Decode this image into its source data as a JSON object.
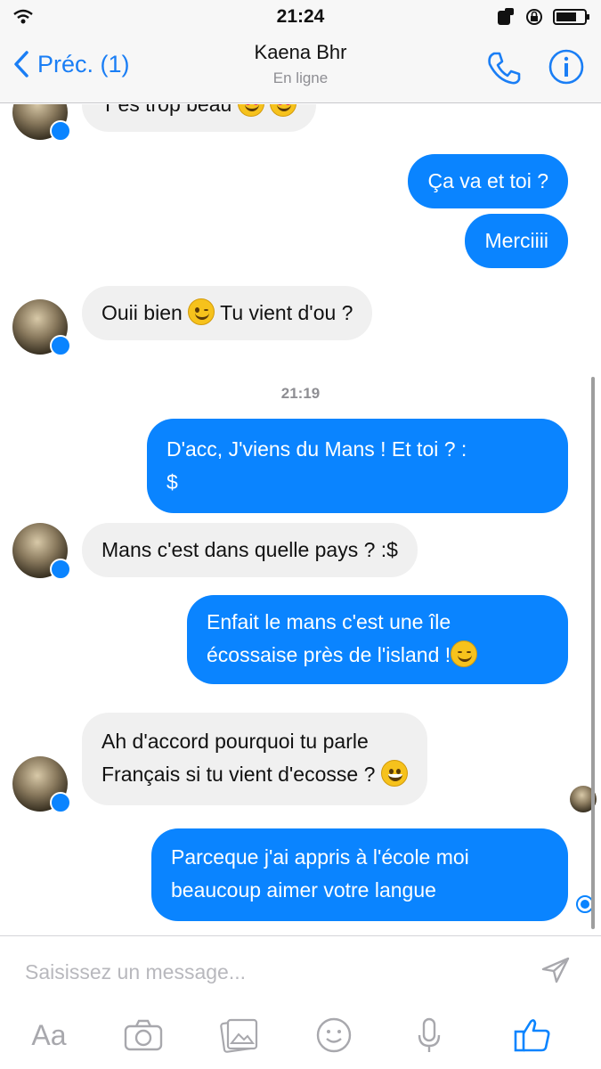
{
  "status_bar": {
    "time": "21:24"
  },
  "nav": {
    "back_label": "Préc. (1)",
    "contact_name": "Kaena Bhr",
    "presence": "En ligne"
  },
  "messages": [
    {
      "direction": "in",
      "text": "T'es trop beau"
    },
    {
      "direction": "out",
      "text": "Ça va et toi ?"
    },
    {
      "direction": "out",
      "text": "Merciiii"
    },
    {
      "direction": "in",
      "text_a": "Ouii bien",
      "text_b": "Tu vient d'ou ?"
    },
    {
      "direction": "out",
      "text_line1": "D'acc, J'viens du Mans ! Et toi ? :",
      "text_line2": "$"
    },
    {
      "direction": "in",
      "text": "Mans c'est dans quelle pays ? :$"
    },
    {
      "direction": "out",
      "text_line1": "Enfait le mans c'est une île",
      "text_line2": "écossaise près de l'island !"
    },
    {
      "direction": "in",
      "text_line1": "Ah d'accord pourquoi tu parle",
      "text_line2": "Français si tu vient d'ecosse ?"
    },
    {
      "direction": "out",
      "text_line1": "Parceque j'ai appris à l'école moi",
      "text_line2": "beaucoup aimer votre langue"
    }
  ],
  "timestamp_divider": "21:19",
  "composer": {
    "placeholder": "Saisissez un message...",
    "text_format_label": "Aa"
  },
  "icons": {
    "back": "chevron-left-icon",
    "call": "phone-icon",
    "info": "info-icon",
    "send": "send-arrow-icon",
    "camera": "camera-icon",
    "gallery": "gallery-icon",
    "emoji": "smiley-icon",
    "voice": "microphone-icon",
    "like": "thumbs-up-icon"
  },
  "colors": {
    "accent": "#0a84ff",
    "incoming_bubble": "#f0f0f0",
    "nav_background": "#f7f7f7"
  }
}
